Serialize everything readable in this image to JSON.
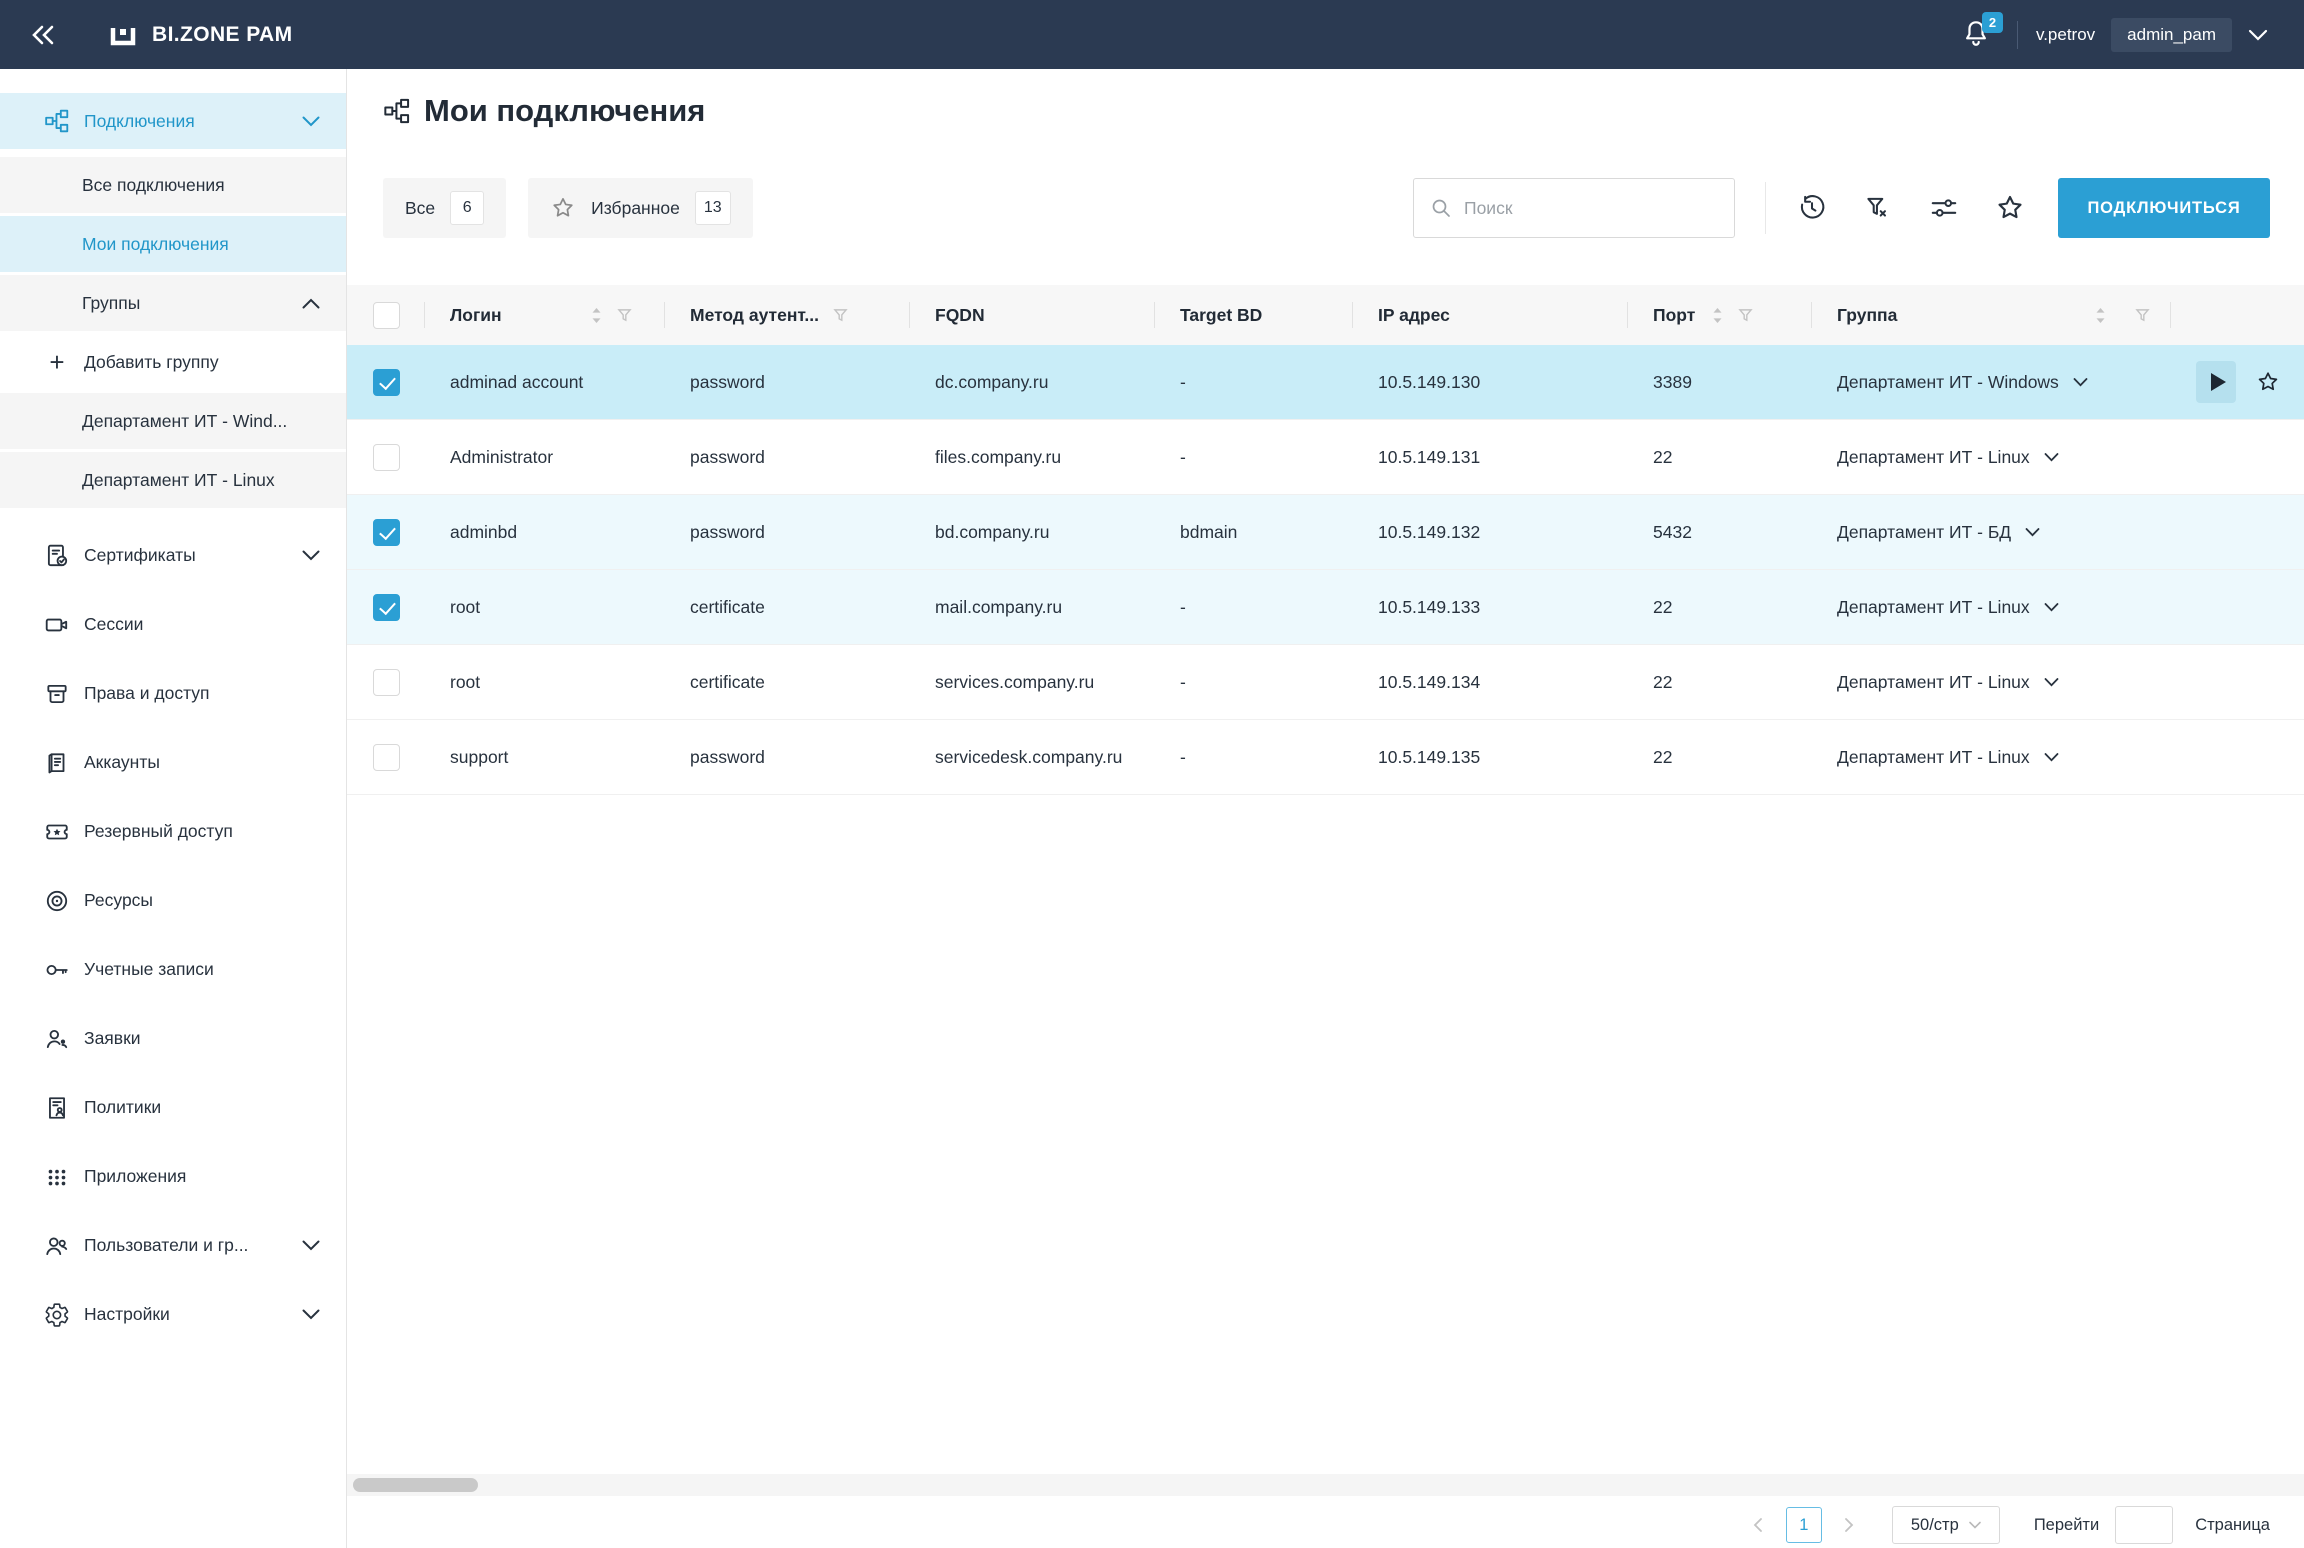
{
  "topbar": {
    "app_title": "BI.ZONE PAM",
    "notification_count": "2",
    "username": "v.petrov",
    "role": "admin_pam"
  },
  "sidebar": {
    "items": [
      {
        "label": "Подключения",
        "active": true,
        "expanded": true
      },
      {
        "label": "Все подключения"
      },
      {
        "label": "Мои подключения",
        "active": true
      },
      {
        "label": "Группы",
        "expanded": true
      },
      {
        "label": "Добавить группу"
      },
      {
        "label": "Департамент ИТ - Wind..."
      },
      {
        "label": "Департамент ИТ - Linux"
      },
      {
        "label": "Сертификаты"
      },
      {
        "label": "Сессии"
      },
      {
        "label": "Права и доступ"
      },
      {
        "label": "Аккаунты"
      },
      {
        "label": "Резервный доступ"
      },
      {
        "label": "Ресурсы"
      },
      {
        "label": "Учетные записи"
      },
      {
        "label": "Заявки"
      },
      {
        "label": "Политики"
      },
      {
        "label": "Приложения"
      },
      {
        "label": "Пользователи и гр..."
      },
      {
        "label": "Настройки"
      }
    ]
  },
  "page": {
    "title": "Мои подключения"
  },
  "filters": {
    "all_label": "Все",
    "all_count": "6",
    "favorites_label": "Избранное",
    "favorites_count": "13"
  },
  "search": {
    "placeholder": "Поиск"
  },
  "actions": {
    "connect_label": "ПОДКЛЮЧИТЬСЯ"
  },
  "table": {
    "columns": [
      "Логин",
      "Метод аутент...",
      "FQDN",
      "Target BD",
      "IP адрес",
      "Порт",
      "Группа"
    ],
    "rows": [
      {
        "checked": true,
        "highlighted": true,
        "login": "adminad account",
        "auth": "password",
        "fqdn": "dc.company.ru",
        "target_bd": "-",
        "ip": "10.5.149.130",
        "port": "3389",
        "group": "Департамент ИТ - Windows"
      },
      {
        "checked": false,
        "highlighted": false,
        "login": "Administrator",
        "auth": "password",
        "fqdn": "files.company.ru",
        "target_bd": "-",
        "ip": "10.5.149.131",
        "port": "22",
        "group": "Департамент ИТ - Linux"
      },
      {
        "checked": true,
        "highlighted": false,
        "login": "adminbd",
        "auth": "password",
        "fqdn": "bd.company.ru",
        "target_bd": "bdmain",
        "ip": "10.5.149.132",
        "port": "5432",
        "group": "Департамент ИТ - БД"
      },
      {
        "checked": true,
        "highlighted": false,
        "login": "root",
        "auth": "certificate",
        "fqdn": "mail.company.ru",
        "target_bd": "-",
        "ip": "10.5.149.133",
        "port": "22",
        "group": "Департамент ИТ - Linux"
      },
      {
        "checked": false,
        "highlighted": false,
        "login": "root",
        "auth": "certificate",
        "fqdn": "services.company.ru",
        "target_bd": "-",
        "ip": "10.5.149.134",
        "port": "22",
        "group": "Департамент ИТ - Linux"
      },
      {
        "checked": false,
        "highlighted": false,
        "login": "support",
        "auth": "password",
        "fqdn": "servicedesk.company.ru",
        "target_bd": "-",
        "ip": "10.5.149.135",
        "port": "22",
        "group": "Департамент ИТ - Linux"
      }
    ]
  },
  "pagination": {
    "current_page": "1",
    "page_size": "50/стр",
    "goto_label": "Перейти",
    "page_label": "Страница"
  },
  "colors": {
    "accent": "#2b9fd4",
    "topbar_bg": "#2b3a52",
    "row_highlight": "#c9edf8",
    "row_checked_tint": "#edf9fd",
    "sidebar_active_bg": "#ddf1f9",
    "sidebar_active_text": "#2196c9"
  }
}
